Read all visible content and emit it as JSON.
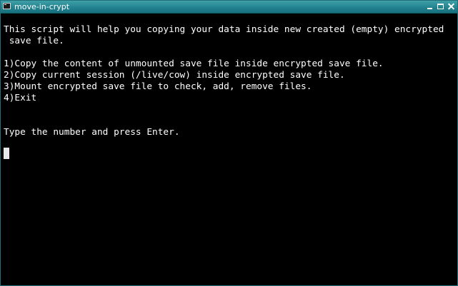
{
  "window": {
    "title": "move-in-crypt"
  },
  "terminal": {
    "lines": [
      "This script will help you copying your data inside new created (empty) encrypted",
      " save file.",
      "1)Copy the content of unmounted save file inside encrypted save file.",
      "2)Copy current session (/live/cow) inside encrypted save file.",
      "3)Mount encrypted save file to check, add, remove files.",
      "4)Exit",
      "Type the number and press Enter."
    ]
  },
  "colors": {
    "titlebar": "#238390",
    "background": "#000000",
    "text": "#ffffff"
  },
  "icons": {
    "app": "terminal-icon",
    "minimize": "minimize-icon",
    "maximize": "maximize-icon",
    "close": "close-icon"
  }
}
